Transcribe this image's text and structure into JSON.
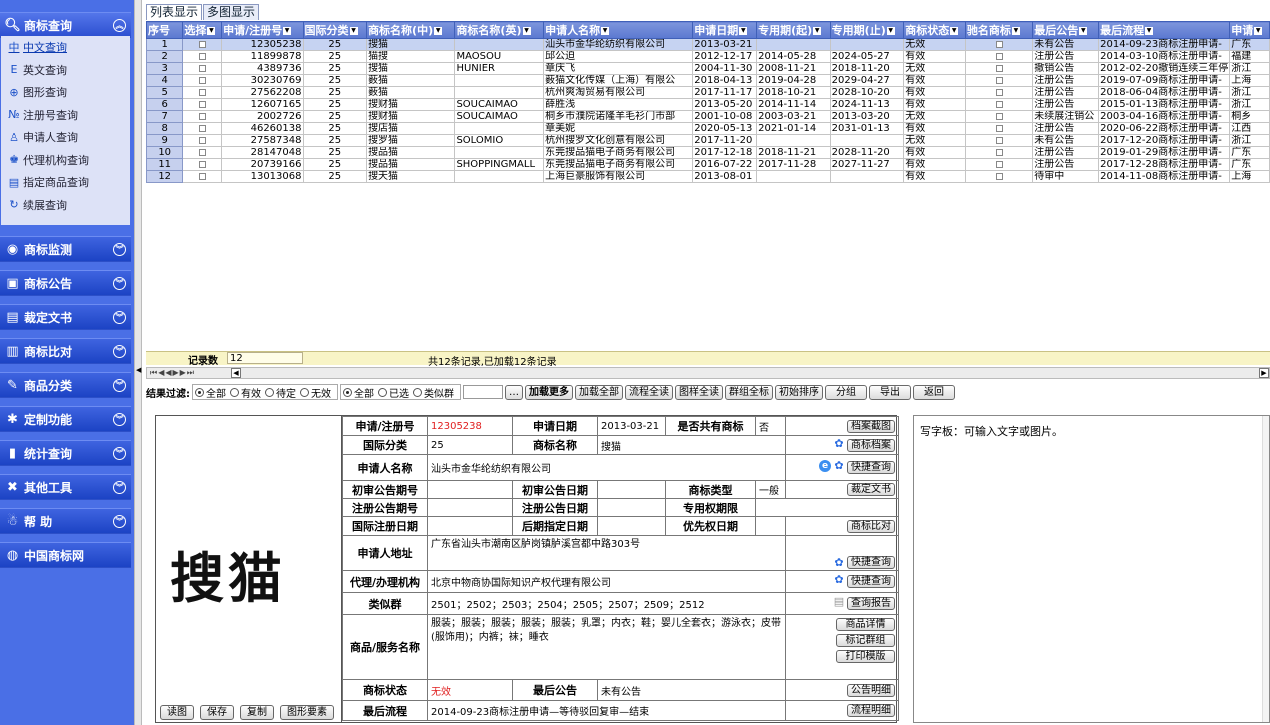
{
  "sidebar": {
    "query": {
      "title": "商标查询",
      "items": [
        {
          "icon": "chinese-icon",
          "glyph": "中",
          "label": "中文查询"
        },
        {
          "icon": "english-icon",
          "glyph": "E",
          "label": "英文查询"
        },
        {
          "icon": "shape-icon",
          "glyph": "⊕",
          "label": "图形查询"
        },
        {
          "icon": "number-icon",
          "glyph": "№",
          "label": "注册号查询"
        },
        {
          "icon": "person-icon",
          "glyph": "♙",
          "label": "申请人查询"
        },
        {
          "icon": "agency-icon",
          "glyph": "♚",
          "label": "代理机构查询"
        },
        {
          "icon": "cart-icon",
          "glyph": "▤",
          "label": "指定商品查询"
        },
        {
          "icon": "refresh-icon",
          "glyph": "↻",
          "label": "续展查询"
        }
      ]
    },
    "sections": [
      {
        "name": "monitor",
        "label": "商标监测",
        "icon": "monitor-icon",
        "glyph": "◉"
      },
      {
        "name": "notice",
        "label": "商标公告",
        "icon": "notice-icon",
        "glyph": "▣"
      },
      {
        "name": "ruling",
        "label": "裁定文书",
        "icon": "document-icon",
        "glyph": "▤"
      },
      {
        "name": "compare",
        "label": "商标比对",
        "icon": "compare-icon",
        "glyph": "▥"
      },
      {
        "name": "category",
        "label": "商品分类",
        "icon": "category-icon",
        "glyph": "✎"
      },
      {
        "name": "custom",
        "label": "定制功能",
        "icon": "custom-icon",
        "glyph": "✱"
      },
      {
        "name": "stats",
        "label": "统计查询",
        "icon": "stats-icon",
        "glyph": "▮"
      },
      {
        "name": "tools",
        "label": "其他工具",
        "icon": "tools-icon",
        "glyph": "✖"
      },
      {
        "name": "help",
        "label": "帮 助",
        "icon": "help-icon",
        "glyph": "☃"
      },
      {
        "name": "cn-net",
        "label": "中国商标网",
        "icon": "globe-icon",
        "glyph": "◍"
      }
    ]
  },
  "tabs": [
    "列表显示",
    "多图显示"
  ],
  "grid": {
    "columns": [
      "序号",
      "选择",
      "申请/注册号",
      "国际分类",
      "商标名称(中)",
      "商标名称(英)",
      "申请人名称",
      "申请日期",
      "专用期(起)",
      "专用期(止)",
      "商标状态",
      "驰名商标",
      "最后公告",
      "最后流程",
      "申请"
    ],
    "rows": [
      [
        "1",
        "12305238",
        "25",
        "搜猫",
        "",
        "汕头市金华纶纺织有限公司",
        "2013-03-21",
        "",
        "",
        "无效",
        "未有公告",
        "2014-09-23商标注册申请-",
        "广东"
      ],
      [
        "2",
        "11899878",
        "25",
        "猫搜",
        "MAOSOU",
        "邱公迫",
        "2012-12-17",
        "2014-05-28",
        "2024-05-27",
        "有效",
        "注册公告",
        "2014-03-10商标注册申请-",
        "福建"
      ],
      [
        "3",
        "4389736",
        "25",
        "搜猫",
        "HUNIER",
        "章庆飞",
        "2004-11-30",
        "2008-11-21",
        "2018-11-20",
        "无效",
        "撤销公告",
        "2012-02-20撤销连续三年停",
        "浙江"
      ],
      [
        "4",
        "30230769",
        "25",
        "薮猫",
        "",
        "薮猫文化传媒（上海）有限公",
        "2018-04-13",
        "2019-04-28",
        "2029-04-27",
        "有效",
        "注册公告",
        "2019-07-09商标注册申请-",
        "上海"
      ],
      [
        "5",
        "27562208",
        "25",
        "薮猫",
        "",
        "杭州爽淘贸易有限公司",
        "2017-11-17",
        "2018-10-21",
        "2028-10-20",
        "有效",
        "注册公告",
        "2018-06-04商标注册申请-",
        "浙江"
      ],
      [
        "6",
        "12607165",
        "25",
        "搜财猫",
        "SOUCAIMAO",
        "薛胜浅",
        "2013-05-20",
        "2014-11-14",
        "2024-11-13",
        "有效",
        "注册公告",
        "2015-01-13商标注册申请-",
        "浙江"
      ],
      [
        "7",
        "2002726",
        "25",
        "搜财猫",
        "SOUCAIMAO",
        "桐乡市濮院诺隆羊毛衫门市部",
        "2001-10-08",
        "2003-03-21",
        "2013-03-20",
        "无效",
        "未续展注销公",
        "2003-04-16商标注册申请-",
        "桐乡"
      ],
      [
        "8",
        "46260138",
        "25",
        "搜店猫",
        "",
        "章美妮",
        "2020-05-13",
        "2021-01-14",
        "2031-01-13",
        "有效",
        "注册公告",
        "2020-06-22商标注册申请-",
        "江西"
      ],
      [
        "9",
        "27587348",
        "25",
        "搜罗猫",
        "SOLOMIO",
        "杭州搜罗文化创意有限公司",
        "2017-11-20",
        "",
        "",
        "无效",
        "未有公告",
        "2017-12-20商标注册申请-",
        "浙江"
      ],
      [
        "10",
        "28147048",
        "25",
        "搜品猫",
        "",
        "东莞搜品猫电子商务有限公司",
        "2017-12-18",
        "2018-11-21",
        "2028-11-20",
        "有效",
        "注册公告",
        "2019-01-29商标注册申请-",
        "广东"
      ],
      [
        "11",
        "20739166",
        "25",
        "搜品猫",
        "SHOPPINGMALL",
        "东莞搜品猫电子商务有限公司",
        "2016-07-22",
        "2017-11-28",
        "2027-11-27",
        "有效",
        "注册公告",
        "2017-12-28商标注册申请-",
        "广东"
      ],
      [
        "12",
        "13013068",
        "25",
        "搜天猫",
        "",
        "上海巨豪服饰有限公司",
        "2013-08-01",
        "",
        "",
        "有效",
        "待审中",
        "2014-11-08商标注册申请-",
        "上海"
      ]
    ]
  },
  "status": {
    "label": "记录数",
    "count": "12",
    "message": "共12条记录,已加载12条记录"
  },
  "filter": {
    "label": "结果过滤:",
    "status_options": [
      "全部",
      "有效",
      "待定",
      "无效"
    ],
    "select_options": [
      "全部",
      "已选",
      "类似群"
    ],
    "buttons": [
      "加载更多",
      "加载全部",
      "流程全读",
      "图样全读",
      "群组全标",
      "初始排序",
      "分组",
      "导出",
      "返回"
    ]
  },
  "detail": {
    "mark_text": "搜猫",
    "reg_no_label": "申请/注册号",
    "reg_no": "12305238",
    "app_date_label": "申请日期",
    "app_date": "2013-03-21",
    "shared_label": "是否共有商标",
    "shared": "否",
    "class_label": "国际分类",
    "class": "25",
    "name_label": "商标名称",
    "name": "搜猫",
    "applicant_label": "申请人名称",
    "applicant": "汕头市金华纶纺织有限公司",
    "prelim_no_label": "初审公告期号",
    "prelim_date_label": "初审公告日期",
    "type_label": "商标类型",
    "type": "一般",
    "reg_pub_no_label": "注册公告期号",
    "reg_pub_date_label": "注册公告日期",
    "excl_label": "专用权期限",
    "intl_date_label": "国际注册日期",
    "later_date_label": "后期指定日期",
    "priority_label": "优先权日期",
    "address_label": "申请人地址",
    "address": "广东省汕头市潮南区胪岗镇胪溪宫都中路303号",
    "agent_label": "代理/办理机构",
    "agent": "北京中物商协国际知识产权代理有限公司",
    "similar_label": "类似群",
    "similar": "2501；2502；2503；2504；2505；2507；2509；2512",
    "goods_label": "商品/服务名称",
    "goods": "服装；服装；服装；服装；服装；乳罩；内衣；鞋；婴儿全套衣；游泳衣；皮带(服饰用)；内裤；袜；睡衣",
    "mstatus_label": "商标状态",
    "mstatus": "无效",
    "last_notice_label": "最后公告",
    "last_notice": "未有公告",
    "last_flow_label": "最后流程",
    "last_flow": "2014-09-23商标注册申请—等待驳回复审—结束",
    "btn_archive_img": "档案截图",
    "btn_archive": "商标档案",
    "btn_quick": "快捷查询",
    "btn_ruling": "裁定文书",
    "btn_compare": "商标比对",
    "btn_report": "查询报告",
    "btn_goods": "商品详情",
    "btn_group": "标记群组",
    "btn_print": "打印模版",
    "btn_notice": "公告明细",
    "btn_flow": "流程明细",
    "img_buttons": [
      "读图",
      "保存",
      "复制",
      "图形要素"
    ]
  },
  "scratchpad": {
    "text": "写字板：可输入文字或图片。"
  },
  "colors": {
    "sidebar": "#4a6fe6",
    "header": "#5b78d0",
    "invalid": "#e02020",
    "status_bar": "#f8f4c6"
  }
}
